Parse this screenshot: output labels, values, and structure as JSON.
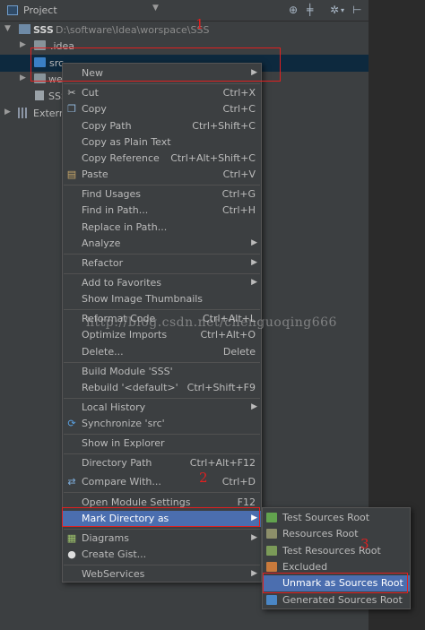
{
  "header": {
    "title": "Project",
    "icons": [
      "target-icon",
      "split-icon",
      "gear-icon",
      "pin-icon"
    ]
  },
  "tree": {
    "root": {
      "name": "SSS",
      "path": "D:\\software\\Idea\\worspace\\SSS"
    },
    "idea": ".idea",
    "src": "src",
    "we": "we",
    "sss_file": "SSS",
    "external": "Extern"
  },
  "menu": {
    "new": "New",
    "cut": "Cut",
    "cut_sc": "Ctrl+X",
    "copy": "Copy",
    "copy_sc": "Ctrl+C",
    "copy_path": "Copy Path",
    "copy_path_sc": "Ctrl+Shift+C",
    "copy_plain": "Copy as Plain Text",
    "copy_ref": "Copy Reference",
    "copy_ref_sc": "Ctrl+Alt+Shift+C",
    "paste": "Paste",
    "paste_sc": "Ctrl+V",
    "find_usages": "Find Usages",
    "find_usages_sc": "Ctrl+G",
    "find_in_path": "Find in Path...",
    "find_in_path_sc": "Ctrl+H",
    "replace_in_path": "Replace in Path...",
    "analyze": "Analyze",
    "refactor": "Refactor",
    "add_favorites": "Add to Favorites",
    "show_thumbs": "Show Image Thumbnails",
    "reformat": "Reformat Code",
    "reformat_sc": "Ctrl+Alt+L",
    "optimize": "Optimize Imports",
    "optimize_sc": "Ctrl+Alt+O",
    "delete": "Delete...",
    "delete_sc": "Delete",
    "build_module": "Build Module 'SSS'",
    "rebuild": "Rebuild '<default>'",
    "rebuild_sc": "Ctrl+Shift+F9",
    "local_history": "Local History",
    "synchronize": "Synchronize 'src'",
    "show_explorer": "Show in Explorer",
    "dir_path": "Directory Path",
    "dir_path_sc": "Ctrl+Alt+F12",
    "compare_with": "Compare With...",
    "compare_with_sc": "Ctrl+D",
    "module_settings": "Open Module Settings",
    "module_settings_sc": "F12",
    "mark_dir": "Mark Directory as",
    "diagrams": "Diagrams",
    "create_gist": "Create Gist...",
    "webservices": "WebServices"
  },
  "submenu": {
    "test_sources": "Test Sources Root",
    "resources": "Resources Root",
    "test_resources": "Test Resources Root",
    "excluded": "Excluded",
    "unmark": "Unmark as Sources Root",
    "generated": "Generated Sources Root"
  },
  "annotations": {
    "n1": "1",
    "n2": "2",
    "n3": "3"
  },
  "watermark": "http://blog.csdn.net/chenguoqing666",
  "colors": {
    "highlight": "#4b6eaf",
    "annotation": "#e02020",
    "source_folder": "#3a7fc4"
  }
}
